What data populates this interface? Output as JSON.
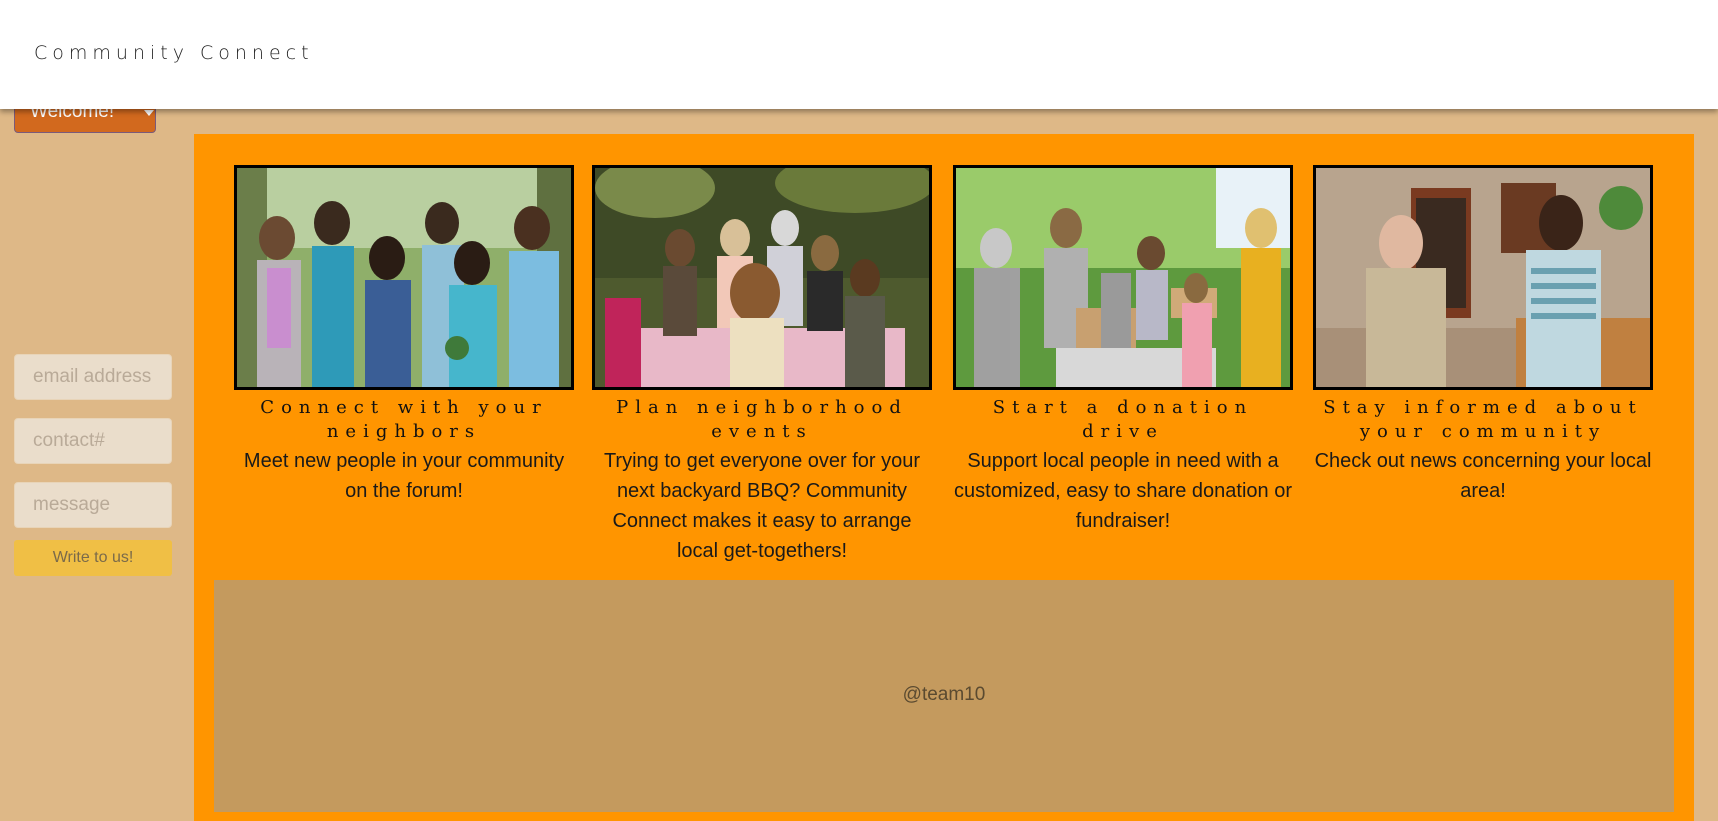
{
  "header": {
    "brand": "Community Connect"
  },
  "welcome_menu": {
    "label": "Welcome!"
  },
  "contact_form": {
    "email_placeholder": "email address",
    "contact_placeholder": "contact#",
    "message_placeholder": "message",
    "submit_label": "Write to us!"
  },
  "features": [
    {
      "title": "Connect with your neighbors",
      "description": "Meet new people in your community on the forum!"
    },
    {
      "title": "Plan neighborhood events",
      "description": "Trying to get everyone over for your next backyard BBQ? Community Connect makes it easy to arrange local get-togethers!"
    },
    {
      "title": "Start a donation drive",
      "description": "Support local people in need with a customized, easy to share donation or fundraiser!"
    },
    {
      "title": "Stay informed about your community",
      "description": "Check out news concerning your local area!"
    }
  ],
  "footer": {
    "text": "@team10"
  },
  "colors": {
    "page_bg": "#DEB887",
    "panel_bg": "#FF9500",
    "footer_bg": "#C49A5E",
    "dropdown_bg": "#D2691E",
    "submit_bg": "#F0BF45"
  }
}
